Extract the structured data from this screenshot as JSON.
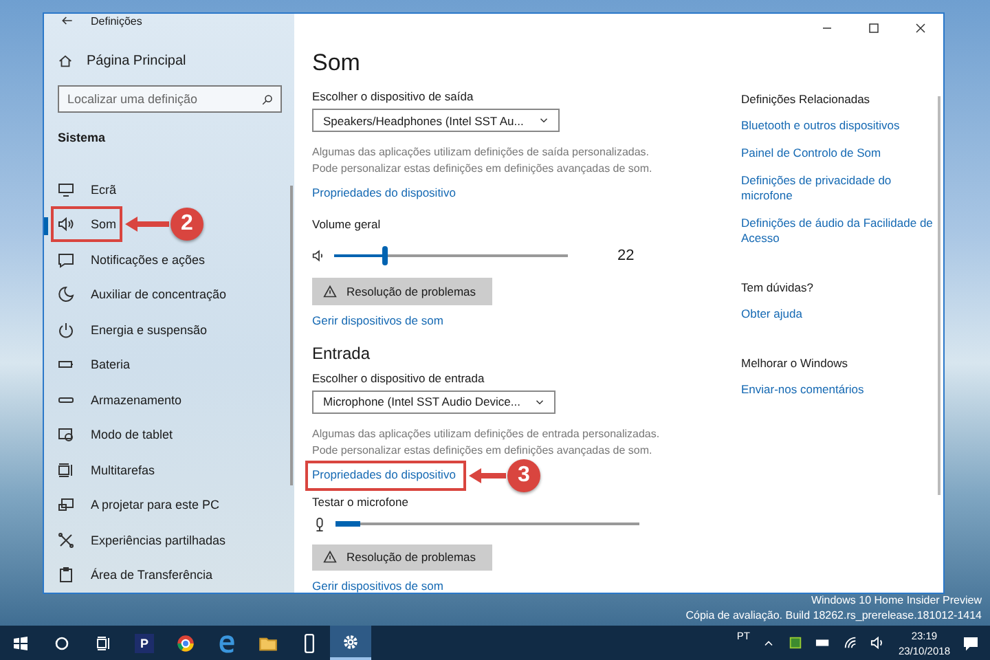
{
  "window": {
    "title": "Definições"
  },
  "sidebar": {
    "home": "Página Principal",
    "search": {
      "placeholder": "Localizar uma definição"
    },
    "section": "Sistema",
    "items": [
      {
        "label": "Ecrã",
        "selected": false
      },
      {
        "label": "Som",
        "selected": true
      },
      {
        "label": "Notificações e ações",
        "selected": false
      },
      {
        "label": "Auxiliar de concentração",
        "selected": false
      },
      {
        "label": "Energia e suspensão",
        "selected": false
      },
      {
        "label": "Bateria",
        "selected": false
      },
      {
        "label": "Armazenamento",
        "selected": false
      },
      {
        "label": "Modo de tablet",
        "selected": false
      },
      {
        "label": "Multitarefas",
        "selected": false
      },
      {
        "label": "A projetar para este PC",
        "selected": false
      },
      {
        "label": "Experiências partilhadas",
        "selected": false
      },
      {
        "label": "Área de Transferência",
        "selected": false
      }
    ]
  },
  "page": {
    "title": "Som",
    "output": {
      "label": "Escolher o dispositivo de saída",
      "device": "Speakers/Headphones (Intel SST Au...",
      "note": "Algumas das aplicações utilizam definições de saída personalizadas. Pode personalizar estas definições em definições avançadas de som.",
      "properties_link": "Propriedades do dispositivo",
      "volume_label": "Volume geral",
      "volume": {
        "level": 0.22,
        "reading": "22"
      },
      "troubleshoot": "Resolução de problemas",
      "manage_link": "Gerir dispositivos de som"
    },
    "input_heading": "Entrada",
    "input": {
      "label": "Escolher o dispositivo de entrada",
      "device": "Microphone (Intel SST Audio Device...",
      "note": "Algumas das aplicações utilizam definições de entrada personalizadas. Pode personalizar estas definições em definições avançadas de som.",
      "properties_link": "Propriedades do dispositivo",
      "mic_label": "Testar o microfone",
      "mic": {
        "level": 0.08
      },
      "troubleshoot": "Resolução de problemas",
      "manage_link": "Gerir dispositivos de som"
    }
  },
  "related": [
    {
      "heading": "Definições Relacionadas",
      "links": [
        "Bluetooth e outros dispositivos",
        "Painel de Controlo de Som",
        "Definições de privacidade do microfone",
        "Definições de áudio da Facilidade de Acesso"
      ]
    },
    {
      "heading": "Tem dúvidas?",
      "links": [
        "Obter ajuda"
      ]
    },
    {
      "heading": "Melhorar o Windows",
      "links": [
        "Enviar-nos comentários"
      ]
    }
  ],
  "annotations": [
    {
      "number": "2"
    },
    {
      "number": "3"
    }
  ],
  "desktop_notice": [
    "Windows 10 Home Insider Preview",
    "Cópia de avaliação. Build 18262.rs_prerelease.181012-1414"
  ],
  "taskbar": {
    "apps": [
      {
        "kind": "p",
        "label": "P",
        "selected": false
      },
      {
        "kind": "browser",
        "selected": false
      },
      {
        "kind": "edge",
        "selected": false
      },
      {
        "kind": "folder",
        "selected": false
      },
      {
        "kind": "phone",
        "selected": false
      },
      {
        "kind": "settings",
        "selected": true
      }
    ],
    "language": "PT",
    "time": "23:19",
    "date": "23/10/2018"
  }
}
